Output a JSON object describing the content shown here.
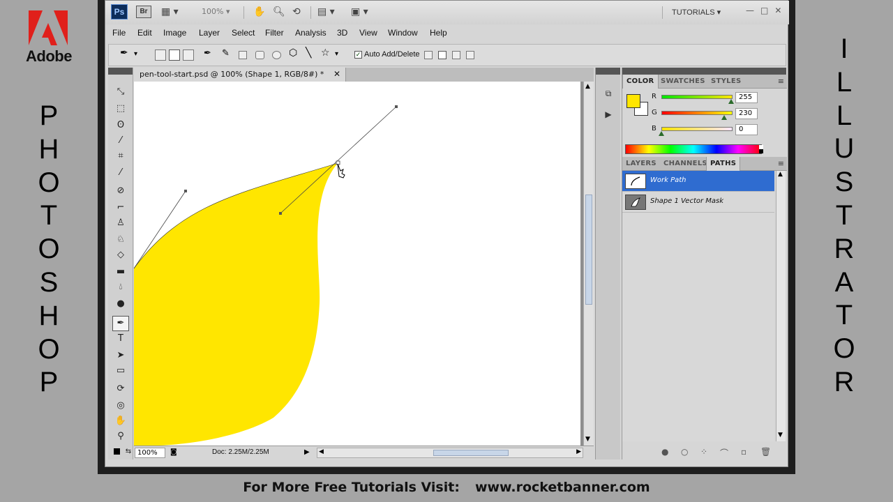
{
  "branding": {
    "adobe": "Adobe",
    "left_vertical": [
      "P",
      "H",
      "O",
      "T",
      "O",
      "S",
      "H",
      "O",
      "P"
    ],
    "right_vertical": [
      "I",
      "L",
      "L",
      "U",
      "S",
      "T",
      "R",
      "A",
      "T",
      "O",
      "R"
    ],
    "banner_prefix": "For More Free Tutorials Visit:",
    "banner_url": "www.rocketbanner.com"
  },
  "appbar": {
    "ps_logo": "Ps",
    "br_logo": "Br",
    "zoom": "100%",
    "workspace": "TUTORIALS",
    "icons": [
      "hand-icon",
      "zoom-icon",
      "rotate-view-icon",
      "arrange-documents-icon",
      "screen-mode-icon"
    ]
  },
  "menu": [
    "File",
    "Edit",
    "Image",
    "Layer",
    "Select",
    "Filter",
    "Analysis",
    "3D",
    "View",
    "Window",
    "Help"
  ],
  "options": {
    "auto_add_delete": "Auto Add/Delete",
    "auto_add_checked": true
  },
  "document": {
    "tab_title": "pen-tool-start.psd @ 100% (Shape 1, RGB/8#) *",
    "zoom": "100%",
    "doc_info": "Doc: 2.25M/2.25M"
  },
  "color_panel": {
    "tabs": [
      "COLOR",
      "SWATCHES",
      "STYLES"
    ],
    "active_tab": "COLOR",
    "foreground": "#ffe600",
    "channels": [
      {
        "label": "R",
        "value": "255"
      },
      {
        "label": "G",
        "value": "230"
      },
      {
        "label": "B",
        "value": "0"
      }
    ]
  },
  "paths_panel": {
    "tabs": [
      "LAYERS",
      "CHANNELS",
      "PATHS"
    ],
    "active_tab": "PATHS",
    "paths": [
      {
        "name": "Work Path",
        "selected": true
      },
      {
        "name": "Shape 1 Vector Mask",
        "selected": false
      }
    ]
  },
  "shape_fill": "#ffe600"
}
